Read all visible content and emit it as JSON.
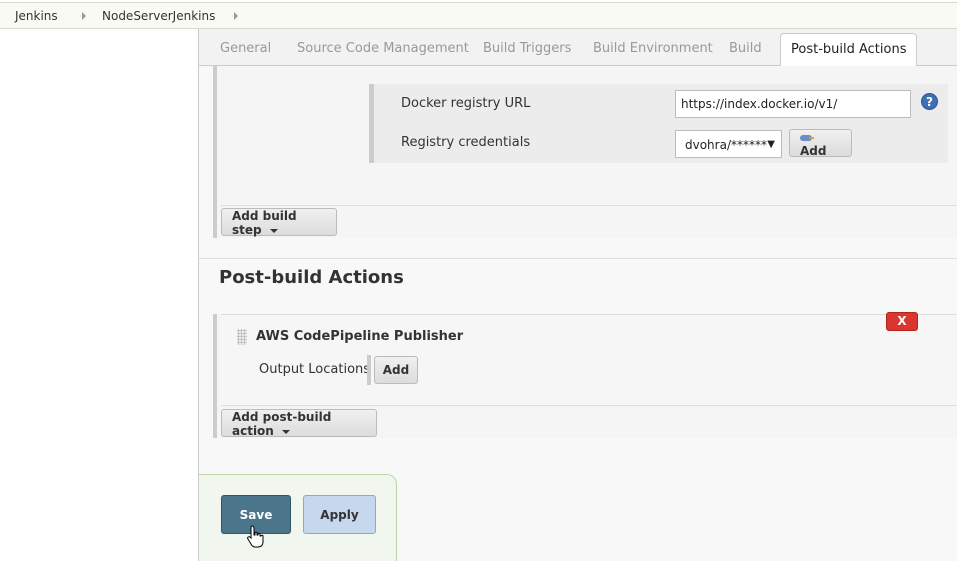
{
  "breadcrumb": {
    "items": [
      {
        "label": "Jenkins"
      },
      {
        "label": "NodeServerJenkins"
      }
    ]
  },
  "tabs": [
    {
      "label": "General",
      "active": false
    },
    {
      "label": "Source Code Management",
      "active": false
    },
    {
      "label": "Build Triggers",
      "active": false
    },
    {
      "label": "Build Environment",
      "active": false
    },
    {
      "label": "Build",
      "active": false
    },
    {
      "label": "Post-build Actions",
      "active": true
    }
  ],
  "docker": {
    "registry_url_label": "Docker registry URL",
    "registry_url_value": "https://index.docker.io/v1/",
    "credentials_label": "Registry credentials",
    "credentials_selected": "dvohra/******",
    "add_label": "Add",
    "help_glyph": "?"
  },
  "build": {
    "add_step_label": "Add build step"
  },
  "post_build": {
    "heading": "Post-build Actions",
    "publisher_title": "AWS CodePipeline Publisher",
    "delete_label": "X",
    "output_locations_label": "Output Locations",
    "output_add_label": "Add",
    "add_action_label": "Add post-build action"
  },
  "footer": {
    "save_label": "Save",
    "apply_label": "Apply"
  },
  "colors": {
    "save": "#4b758b",
    "apply": "#c5d8ee",
    "delete": "#d9362f",
    "help": "#3d6fb4"
  }
}
